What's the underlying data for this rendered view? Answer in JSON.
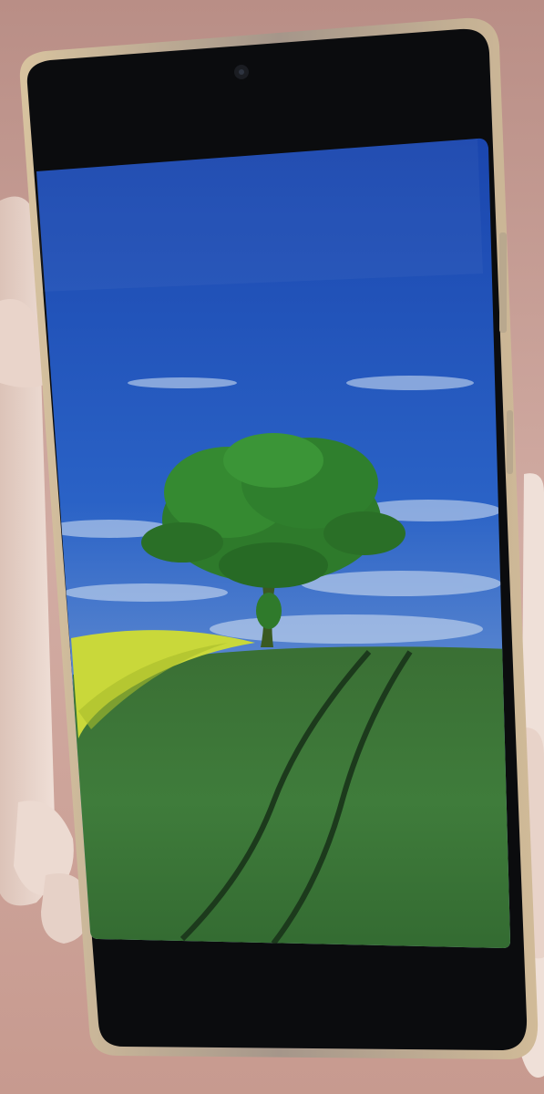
{
  "scene": {
    "subject": "smartphone-held-in-hands-showing-landscape-photo",
    "colors": {
      "background": "#c9a096",
      "sky_top": "#1f4fb8",
      "sky_horizon": "#a9c3e3",
      "field": "#3f7d3b",
      "rapeseed": "#c8d935",
      "tree_foliage": "#2f7a2c",
      "phone_bezel": "#0b0c0e",
      "phone_frame": "#c9b79a",
      "skin": "#ead8cf"
    }
  }
}
